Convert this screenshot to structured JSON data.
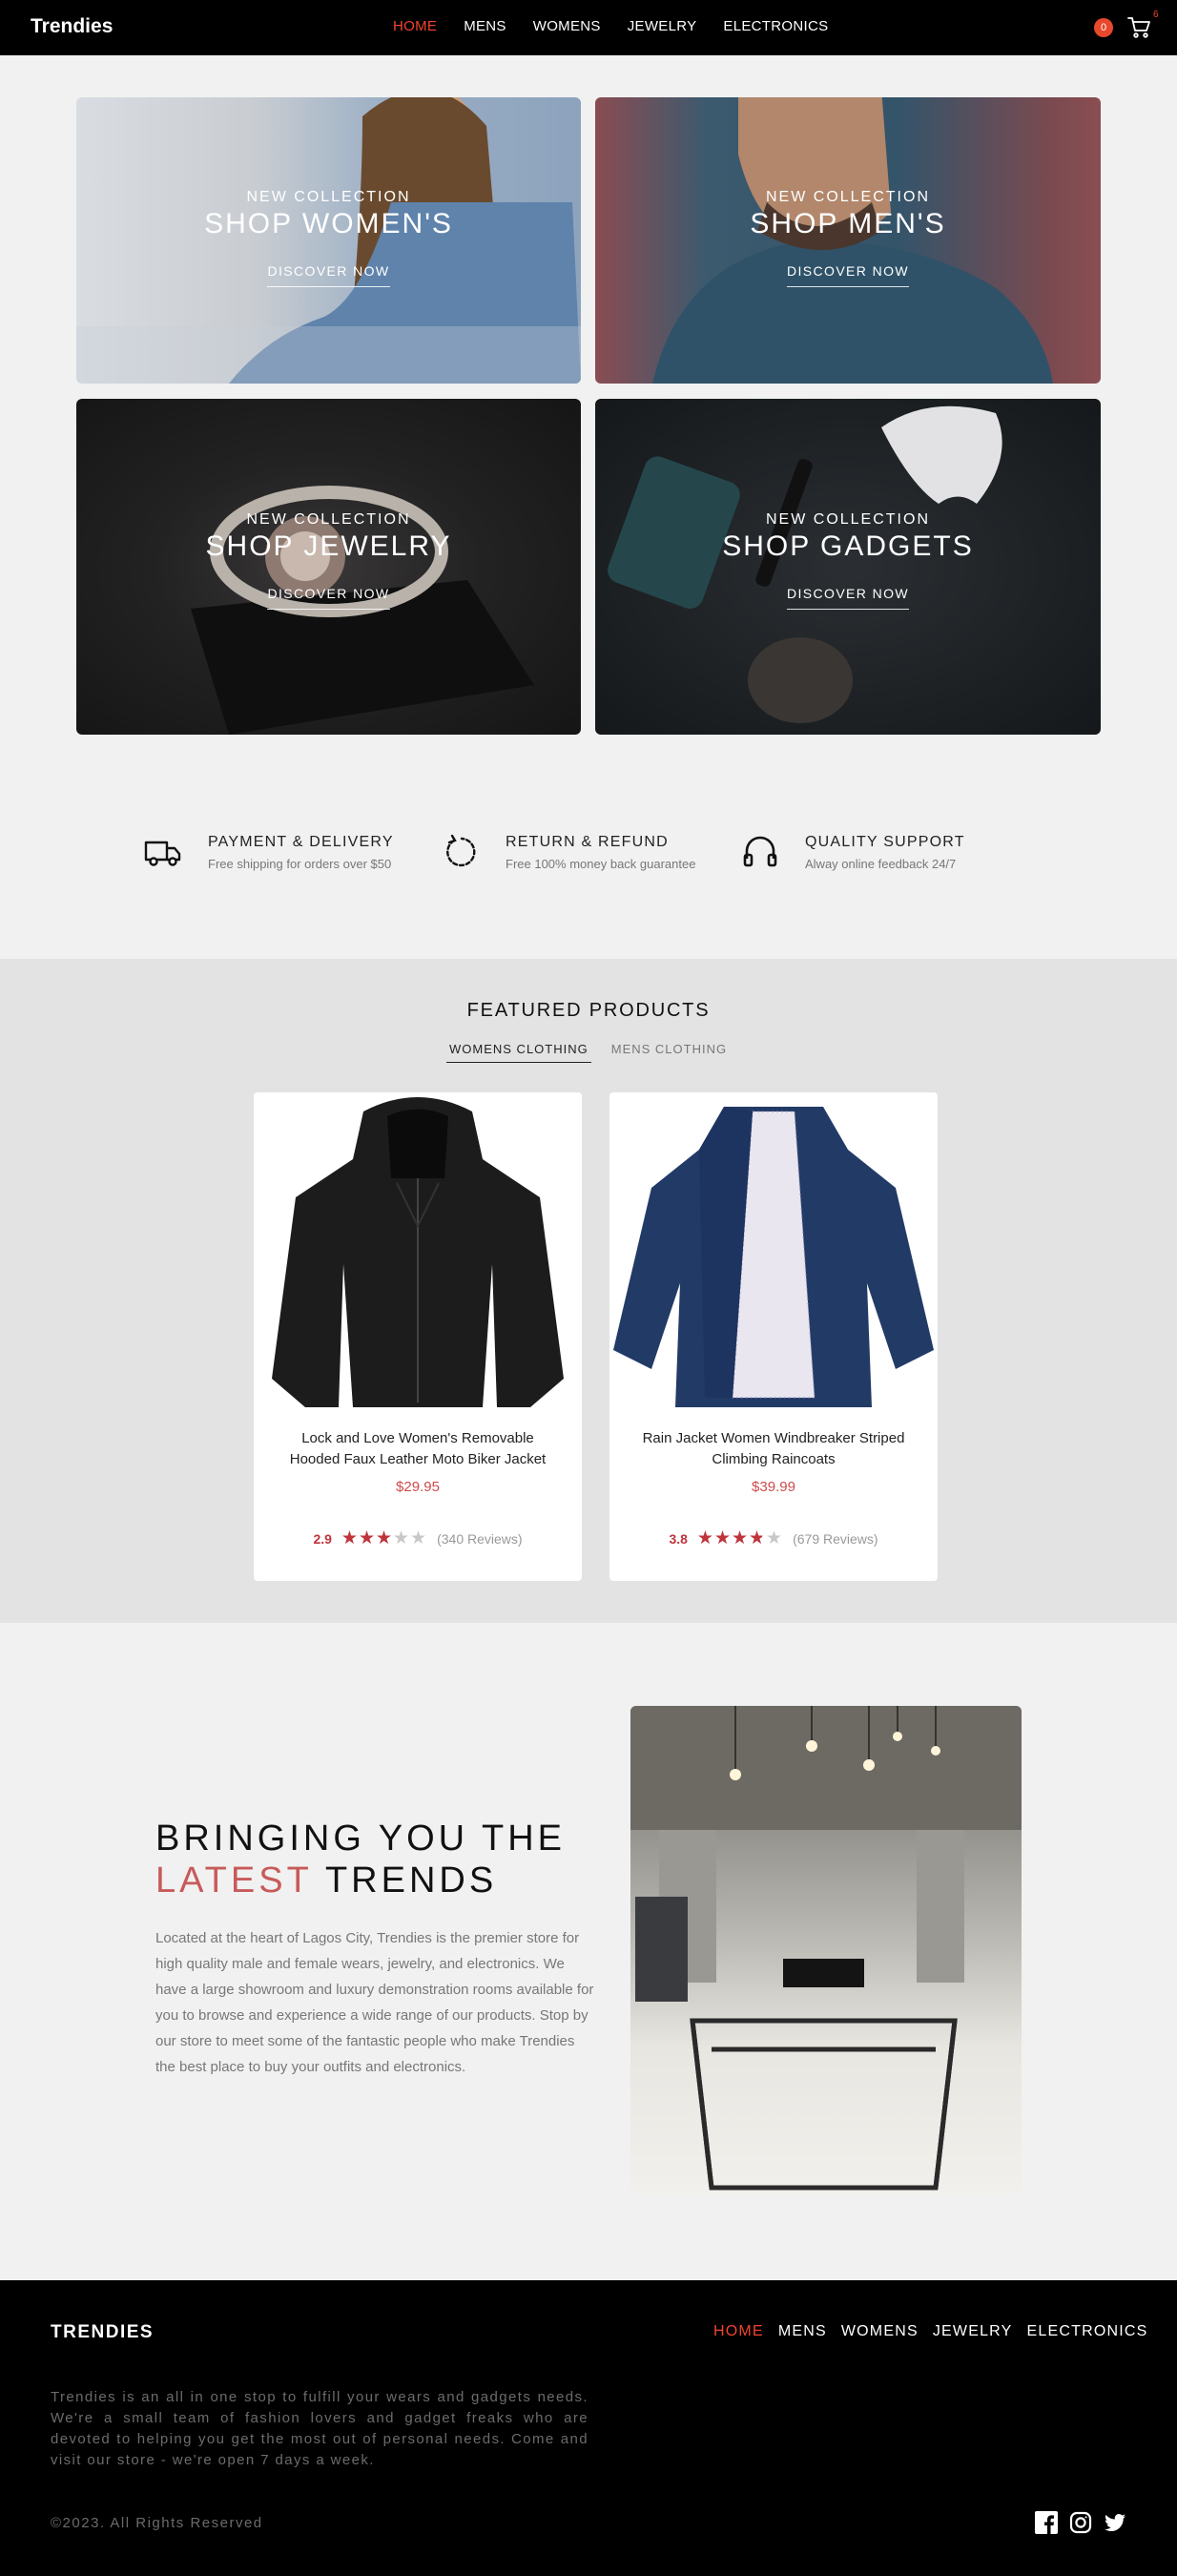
{
  "nav": {
    "brand": "Trendies",
    "items": [
      "HOME",
      "MENS",
      "WOMENS",
      "JEWELRY",
      "ELECTRONICS"
    ],
    "active": "HOME",
    "user_badge": "0",
    "cart_count": "6"
  },
  "tiles": [
    {
      "pre": "NEW COLLECTION",
      "title": "SHOP WOMEN'S",
      "cta": "DISCOVER NOW"
    },
    {
      "pre": "NEW COLLECTION",
      "title": "SHOP MEN'S",
      "cta": "DISCOVER NOW"
    },
    {
      "pre": "NEW COLLECTION",
      "title": "SHOP JEWELRY",
      "cta": "DISCOVER NOW"
    },
    {
      "pre": "NEW COLLECTION",
      "title": "SHOP GADGETS",
      "cta": "DISCOVER NOW"
    }
  ],
  "features": [
    {
      "icon": "truck-icon",
      "title": "PAYMENT & DELIVERY",
      "subtitle": "Free shipping for orders over $50"
    },
    {
      "icon": "refresh-icon",
      "title": "RETURN & REFUND",
      "subtitle": "Free 100% money back guarantee"
    },
    {
      "icon": "headphones-icon",
      "title": "QUALITY SUPPORT",
      "subtitle": "Alway online feedback 24/7"
    }
  ],
  "featured": {
    "title": "FEATURED PRODUCTS",
    "tabs": [
      "WOMENS CLOTHING",
      "MENS CLOTHING"
    ],
    "active_tab": "WOMENS CLOTHING",
    "products": [
      {
        "name": "Lock and Love Women's Removable Hooded Faux Leather Moto Biker Jacket",
        "price": "$29.95",
        "rating": "2.9",
        "rating_value": 2.9,
        "reviews": "(340 Reviews)"
      },
      {
        "name": "Rain Jacket Women Windbreaker Striped Climbing Raincoats",
        "price": "$39.99",
        "rating": "3.8",
        "rating_value": 3.8,
        "reviews": "(679 Reviews)"
      }
    ]
  },
  "about": {
    "heading_line1": "BRINGING YOU THE",
    "heading_highlight": "LATEST",
    "heading_rest": "TRENDS",
    "body": "Located at the heart of Lagos City, Trendies is the premier store for high quality male and female wears, jewelry, and electronics. We have a large showroom and luxury demonstration rooms available for you to browse and experience a wide range of our products. Stop by our store to meet some of the fantastic people who make Trendies the best place to buy your outfits and electronics."
  },
  "footer": {
    "brand": "TRENDIES",
    "items": [
      "HOME",
      "MENS",
      "WOMENS",
      "JEWELRY",
      "ELECTRONICS"
    ],
    "active": "HOME",
    "about": "Trendies is an all in one stop to fulfill your wears and gadgets needs. We're a small team of fashion lovers and gadget freaks who are devoted to helping you get the most out of personal needs. Come and visit our store - we're open 7 days a week.",
    "copyright": "©2023. All Rights Reserved",
    "social": [
      "facebook-icon",
      "instagram-icon",
      "twitter-icon"
    ]
  },
  "colors": {
    "accent": "#f0442e",
    "price": "#cf4b4b",
    "star": "#c0333b",
    "highlight": "#c85a5a"
  }
}
